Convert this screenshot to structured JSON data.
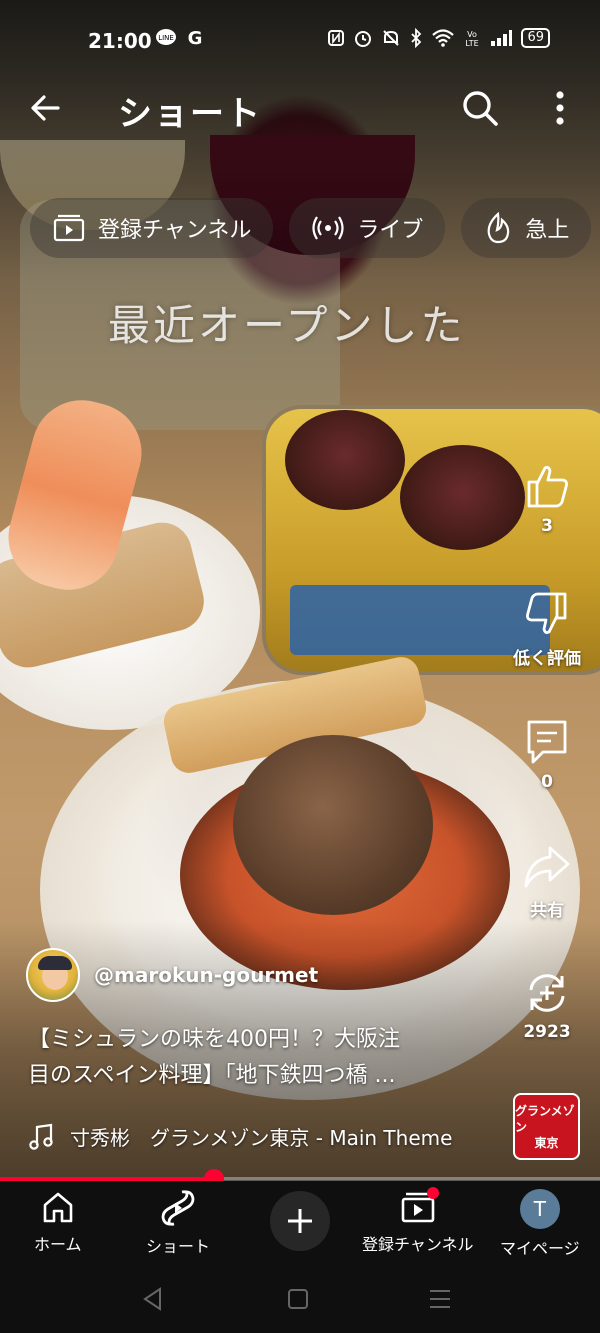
{
  "status_bar": {
    "time": "21:00",
    "left_icons": [
      "line-icon",
      "google-icon"
    ],
    "right_icons": [
      "nfc-icon",
      "alarm-icon",
      "mute-icon",
      "bluetooth-icon",
      "wifi-icon",
      "volte-icon",
      "signal-icon"
    ],
    "battery": "69"
  },
  "header": {
    "title": "ショート"
  },
  "chips": [
    {
      "icon": "subscriptions-icon",
      "label": "登録チャンネル"
    },
    {
      "icon": "live-icon",
      "label": "ライブ"
    },
    {
      "icon": "trending-icon",
      "label": "急上"
    }
  ],
  "overlay_caption": "最近オープンした",
  "actions": {
    "like_count": "3",
    "dislike_label": "低く評価",
    "comment_count": "0",
    "share_label": "共有",
    "remix_count": "2923"
  },
  "channel": {
    "name": "@marokun-gourmet"
  },
  "video": {
    "title_line1": "【ミシュランの味を400円！？大阪注",
    "title_line2": "目のスペイン料理】「地下鉄四つ橋 ..."
  },
  "music": {
    "text": "寸秀彬　グランメゾン東京 - Main Theme",
    "thumb_line1": "グランメゾン",
    "thumb_line2": "東京"
  },
  "progress": {
    "fraction": 0.357
  },
  "bottom_nav": {
    "home": "ホーム",
    "shorts": "ショート",
    "subscriptions": "登録チャンネル",
    "me": "マイページ",
    "me_initial": "T"
  },
  "colors": {
    "accent": "#ff0033",
    "nav_bg": "#0f0f0f"
  }
}
